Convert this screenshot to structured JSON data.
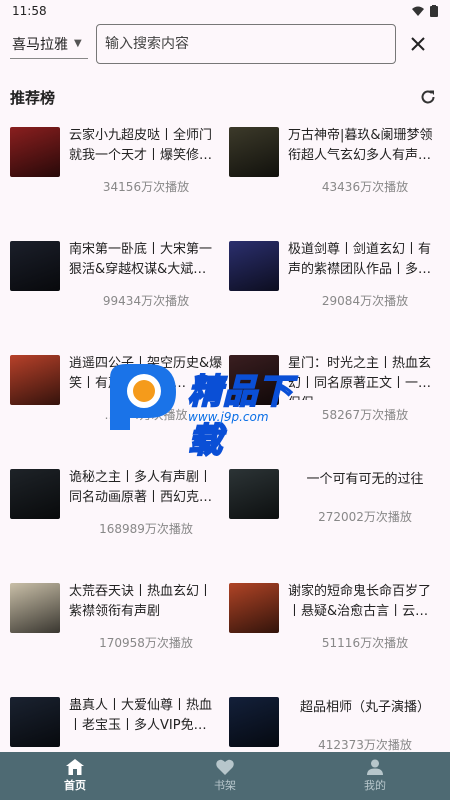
{
  "status_bar": {
    "time": "11:58"
  },
  "search": {
    "source": "喜马拉雅",
    "placeholder": "输入搜索内容"
  },
  "section": {
    "title": "推荐榜"
  },
  "books": [
    {
      "title": "云家小九超皮哒丨全师门就我一个天才丨爆笑修…",
      "plays": "34156万次播放",
      "cover_color": "#8a1f1f",
      "cover_text": ""
    },
    {
      "title": "万古神帝|暮玖&阑珊梦领衔超人气玄幻多人有声…",
      "plays": "43436万次播放",
      "cover_color": "#3c3a2a",
      "cover_text": ""
    },
    {
      "title": "南宋第一卧底丨大宋第一狠活&穿越权谋&大斌…",
      "plays": "99434万次播放",
      "cover_color": "#1b1f2a",
      "cover_text": ""
    },
    {
      "title": "极道剑尊丨剑道玄幻丨有声的紫襟团队作品丨多…",
      "plays": "29084万次播放",
      "cover_color": "#2b2f6e",
      "cover_text": ""
    },
    {
      "title": "逍遥四公子丨架空历史&爆笑丨有声的紫襟衔…",
      "plays": "…634万次播放",
      "cover_color": "#b7412a",
      "cover_text": ""
    },
    {
      "title": "星门：时光之主丨热血玄幻丨同名原著正文丨一种侃侃…",
      "plays": "58267万次播放",
      "cover_color": "#3a1e20",
      "cover_text": ""
    },
    {
      "title": "诡秘之主丨多人有声剧丨同名动画原著丨西幻克…",
      "plays": "168989万次播放",
      "cover_color": "#1e2328",
      "cover_text": ""
    },
    {
      "title": "一个可有可无的过往",
      "plays": "272002万次播放",
      "cover_color": "#2c3436",
      "cover_text": "",
      "single": true
    },
    {
      "title": "太荒吞天诀丨热血玄幻丨紫襟领衔有声剧",
      "plays": "170958万次播放",
      "cover_color": "#c9bfa8",
      "cover_text": ""
    },
    {
      "title": "谢家的短命鬼长命百岁了丨悬疑&治愈古言丨云…",
      "plays": "51116万次播放",
      "cover_color": "#b04426",
      "cover_text": ""
    },
    {
      "title": "蛊真人丨大爱仙尊丨热血丨老宝玉丨多人VIP免…",
      "plays": "",
      "cover_color": "#1a2230",
      "cover_text": ""
    },
    {
      "title": "超品相师（丸子演播）",
      "plays": "412373万次播放",
      "cover_color": "#13203a",
      "cover_text": "",
      "single": true
    }
  ],
  "watermark": {
    "text": "精品下载",
    "url": "www.j9p.com"
  },
  "nav": {
    "home": "首页",
    "shelf": "书架",
    "mine": "我的"
  },
  "colors": {
    "nav_bg": "#4e6a73",
    "background": "#fdf7fb"
  }
}
